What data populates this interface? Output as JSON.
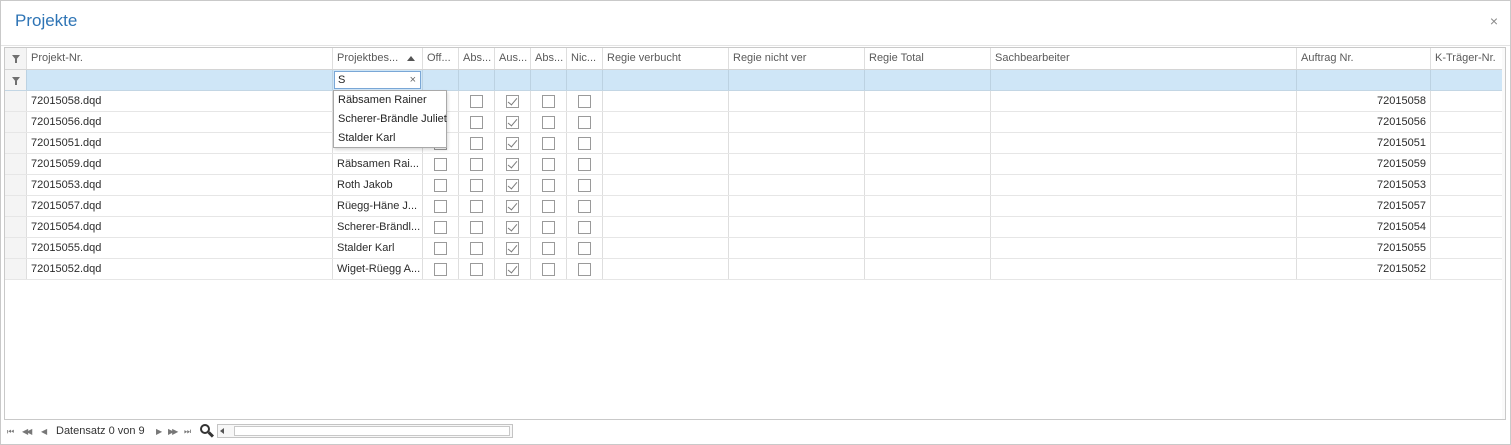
{
  "window": {
    "title": "Projekte",
    "close_label": "×"
  },
  "grid": {
    "columns": [
      {
        "key": "projekt_nr",
        "label": "Projekt-Nr."
      },
      {
        "key": "projektbes",
        "label": "Projektbes...",
        "sorted": "ascending"
      },
      {
        "key": "off",
        "label": "Off..."
      },
      {
        "key": "abs1",
        "label": "Abs..."
      },
      {
        "key": "aus",
        "label": "Aus..."
      },
      {
        "key": "abs2",
        "label": "Abs..."
      },
      {
        "key": "nic",
        "label": "Nic..."
      },
      {
        "key": "regie_verbucht",
        "label": "Regie verbucht"
      },
      {
        "key": "regie_nicht_ver",
        "label": "Regie nicht ver"
      },
      {
        "key": "regie_total",
        "label": "Regie Total"
      },
      {
        "key": "sachbearbeiter",
        "label": "Sachbearbeiter"
      },
      {
        "key": "auftrag_nr",
        "label": "Auftrag Nr."
      },
      {
        "key": "k_traeger_nr",
        "label": "K-Träger-Nr."
      }
    ],
    "filter": {
      "projektbes_value": "S",
      "clear_label": "×"
    },
    "autocomplete": [
      "Räbsamen Rainer",
      "Scherer-Brändle Juliet",
      "Stalder Karl"
    ],
    "rows": [
      {
        "projekt_nr": "72015058.dqd",
        "projektbes": "",
        "off": false,
        "abs1": false,
        "aus": true,
        "abs2": false,
        "nic": false,
        "auftrag_nr": "72015058"
      },
      {
        "projekt_nr": "72015056.dqd",
        "projektbes": "",
        "off": false,
        "abs1": false,
        "aus": true,
        "abs2": false,
        "nic": false,
        "auftrag_nr": "72015056"
      },
      {
        "projekt_nr": "72015051.dqd",
        "projektbes": "",
        "off": false,
        "abs1": false,
        "aus": true,
        "abs2": false,
        "nic": false,
        "auftrag_nr": "72015051"
      },
      {
        "projekt_nr": "72015059.dqd",
        "projektbes": "Räbsamen Rai...",
        "off": false,
        "abs1": false,
        "aus": true,
        "abs2": false,
        "nic": false,
        "auftrag_nr": "72015059"
      },
      {
        "projekt_nr": "72015053.dqd",
        "projektbes": "Roth Jakob",
        "off": false,
        "abs1": false,
        "aus": true,
        "abs2": false,
        "nic": false,
        "auftrag_nr": "72015053"
      },
      {
        "projekt_nr": "72015057.dqd",
        "projektbes": "Rüegg-Häne J...",
        "off": false,
        "abs1": false,
        "aus": true,
        "abs2": false,
        "nic": false,
        "auftrag_nr": "72015057"
      },
      {
        "projekt_nr": "72015054.dqd",
        "projektbes": "Scherer-Brändl...",
        "off": false,
        "abs1": false,
        "aus": true,
        "abs2": false,
        "nic": false,
        "auftrag_nr": "72015054"
      },
      {
        "projekt_nr": "72015055.dqd",
        "projektbes": "Stalder Karl",
        "off": false,
        "abs1": false,
        "aus": true,
        "abs2": false,
        "nic": false,
        "auftrag_nr": "72015055"
      },
      {
        "projekt_nr": "72015052.dqd",
        "projektbes": "Wiget-Rüegg A...",
        "off": false,
        "abs1": false,
        "aus": true,
        "abs2": false,
        "nic": false,
        "auftrag_nr": "72015052"
      }
    ]
  },
  "footer": {
    "record_text": "Datensatz 0 von 9",
    "nav": {
      "first": "⏮",
      "prev_page": "◀◀",
      "prev": "◀",
      "next": "▶",
      "next_page": "▶▶",
      "last": "⏭"
    }
  },
  "colors": {
    "title": "#2e74b5",
    "filter_row": "#cfe6f7",
    "border": "#c9c9c9"
  }
}
